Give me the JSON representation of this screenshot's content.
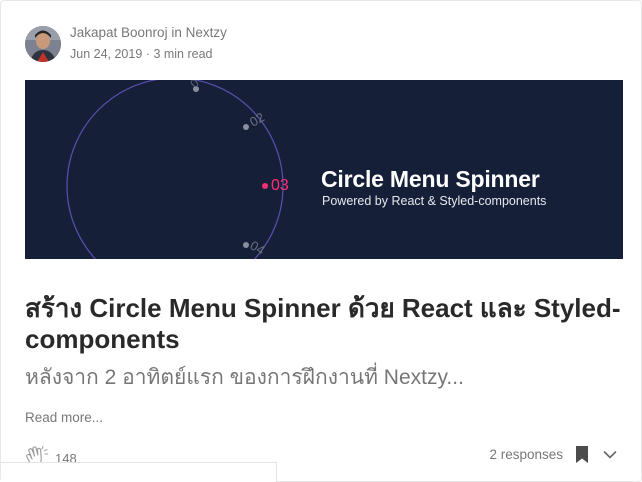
{
  "post": {
    "author": "Jakapat Boonroj",
    "in_word": "in",
    "publication": "Nextzy",
    "date": "Jun 24, 2019",
    "separator": "·",
    "read_time": "3 min read",
    "hero": {
      "title": "Circle Menu Spinner",
      "subtitle": "Powered by React & Styled-components",
      "menu_items": [
        "02",
        "03",
        "04"
      ],
      "active_item": "03",
      "colors": {
        "background": "#152038",
        "accent": "#ff2d74",
        "ring": "#5a4fb0"
      }
    },
    "headline": "สร้าง Circle Menu Spinner ด้วย React และ Styled-components",
    "subtitle": "หลังจาก 2 อาทิตย์แรก ของการฝึกงานที่ Nextzy...",
    "read_more": "Read more...",
    "claps": "148",
    "responses": "2 responses"
  },
  "icons": {
    "clap": "clap-icon",
    "bookmark": "bookmark-icon",
    "more": "chevron-down-icon"
  }
}
